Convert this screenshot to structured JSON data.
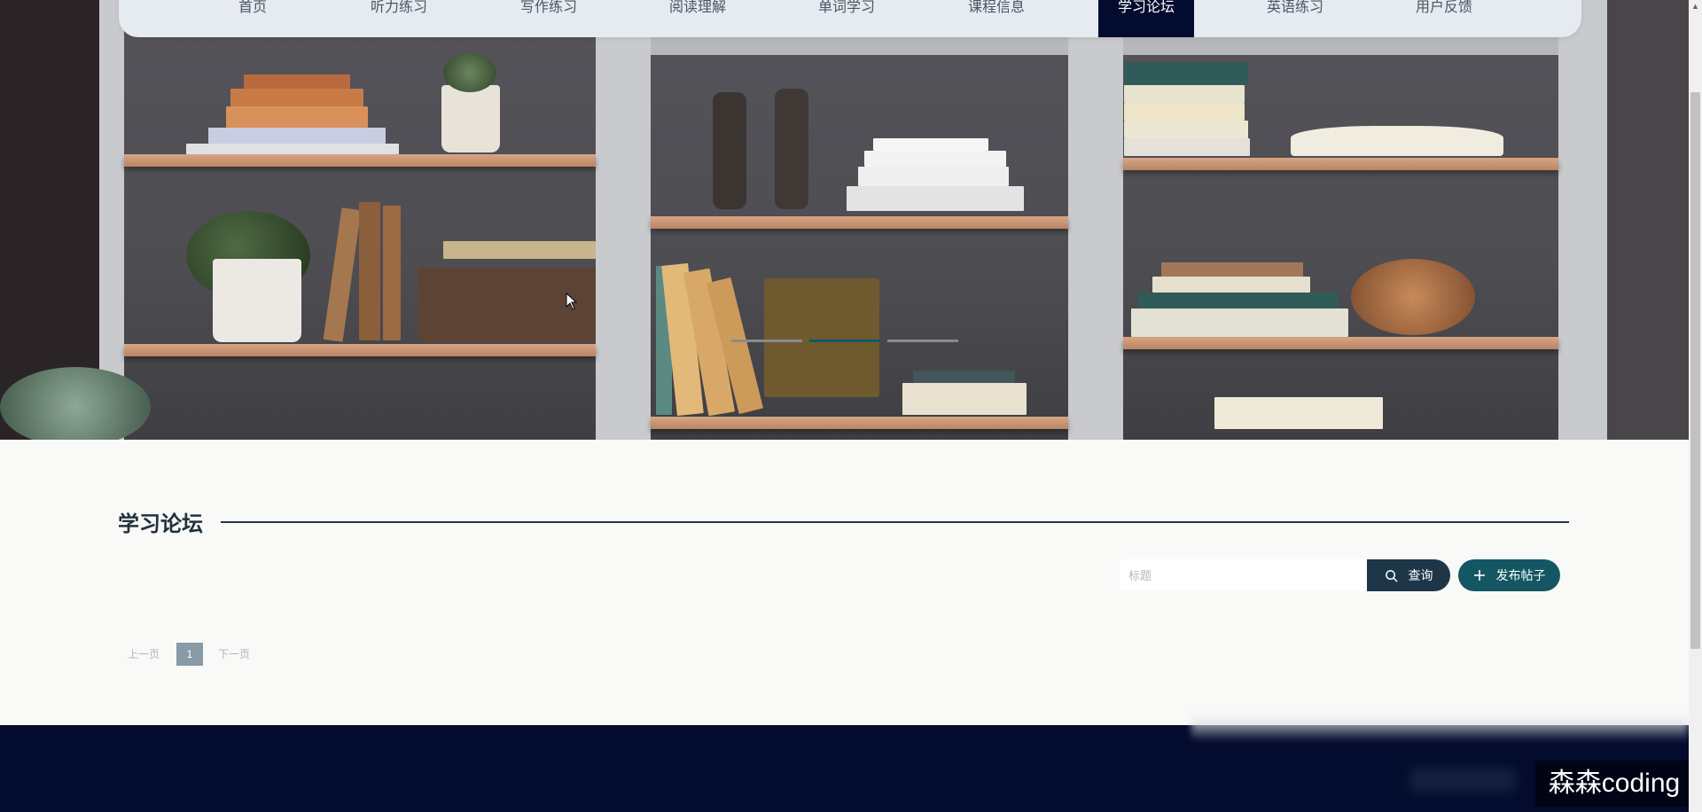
{
  "nav": {
    "items": [
      {
        "label": "首页"
      },
      {
        "label": "听力练习"
      },
      {
        "label": "写作练习"
      },
      {
        "label": "阅读理解"
      },
      {
        "label": "单词学习"
      },
      {
        "label": "课程信息"
      },
      {
        "label": "学习论坛"
      },
      {
        "label": "英语练习"
      },
      {
        "label": "用户反馈"
      }
    ],
    "active_label": "学习论坛"
  },
  "carousel": {
    "slide_count": 3,
    "active_index": 1
  },
  "forum": {
    "title": "学习论坛",
    "search_placeholder": "标题",
    "search_value": "",
    "query_label": "查询",
    "publish_label": "发布帖子"
  },
  "pagination": {
    "prev_label": "上一页",
    "current_page": "1",
    "next_label": "下一页"
  },
  "watermark": {
    "text": "森森coding"
  },
  "colors": {
    "nav_bg": "#e6ebf1",
    "nav_active": "#030b2e",
    "primary": "#1e3748",
    "publish": "#145763",
    "footer": "#030b2e"
  },
  "icons": {
    "query": "search-icon",
    "publish": "plus-icon"
  }
}
